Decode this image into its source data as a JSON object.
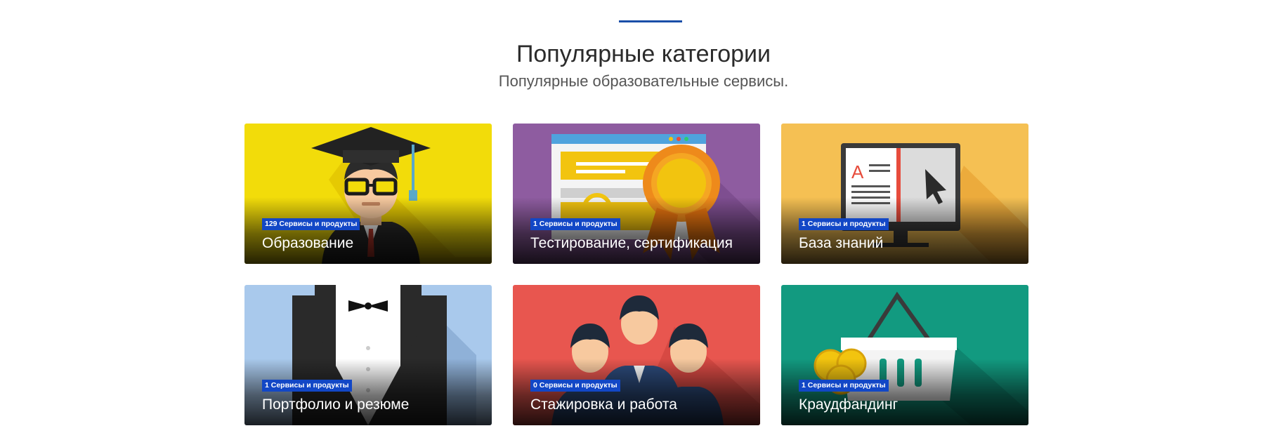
{
  "section": {
    "title": "Популярные категории",
    "subtitle": "Популярные образовательные сервисы."
  },
  "categories": [
    {
      "name": "Образование",
      "count": "129 Сервисы и продукты",
      "bg": "#f2dc0a",
      "icon": "graduate-icon"
    },
    {
      "name": "Тестирование, сертификация",
      "count": "1 Сервисы и продукты",
      "bg": "#8e5ca0",
      "icon": "certificate-icon"
    },
    {
      "name": "База знаний",
      "count": "1 Сервисы и продукты",
      "bg": "#f5c053",
      "icon": "knowledge-icon"
    },
    {
      "name": "Портфолио и резюме",
      "count": "1 Сервисы и продукты",
      "bg": "#a9c9ec",
      "icon": "suit-icon"
    },
    {
      "name": "Стажировка и работа",
      "count": "0 Сервисы и продукты",
      "bg": "#e8564f",
      "icon": "team-icon"
    },
    {
      "name": "Краудфандинг",
      "count": "1 Сервисы и продукты",
      "bg": "#129a80",
      "icon": "basket-icon"
    }
  ]
}
